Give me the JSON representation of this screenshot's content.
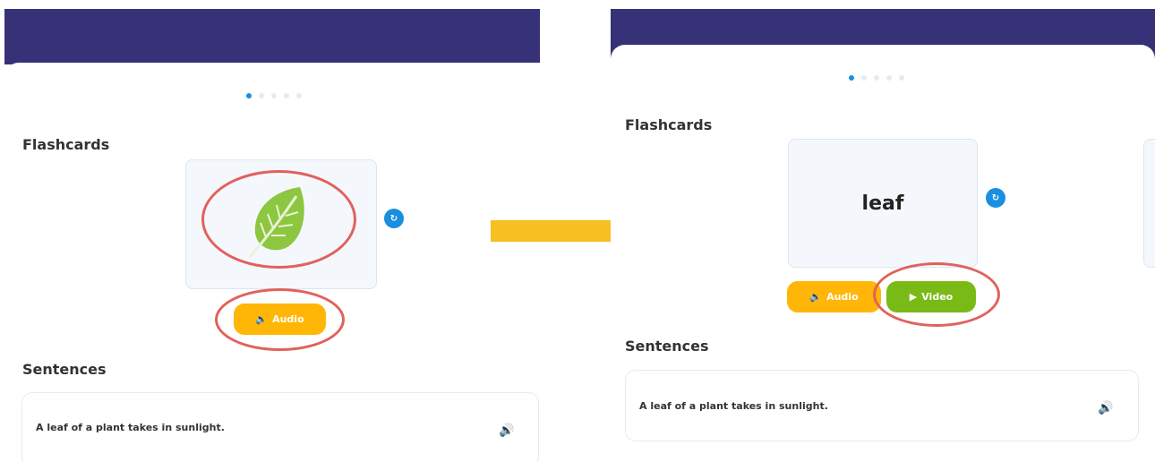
{
  "colors": {
    "header": "#373178",
    "accent_blue": "#1a8fe0",
    "audio": "#ffb606",
    "video": "#7aba16",
    "highlight": "#e2615c",
    "arrow": "#f6bf22"
  },
  "left_panel": {
    "flashcards_title": "Flashcards",
    "card_image_icon": "leaf-icon",
    "flip_icon": "flip-icon",
    "audio_label": "Audio",
    "sentences_title": "Sentences",
    "sentence_text": "A leaf of a plant takes in sunlight."
  },
  "right_panel": {
    "flashcards_title": "Flashcards",
    "card_word": "leaf",
    "flip_icon": "flip-icon",
    "audio_label": "Audio",
    "video_label": "Video",
    "sentences_title": "Sentences",
    "sentence_text": "A leaf of a plant takes in sunlight."
  },
  "pagination": {
    "total": 5,
    "active_index": 0
  },
  "transition_arrow": "right-arrow"
}
